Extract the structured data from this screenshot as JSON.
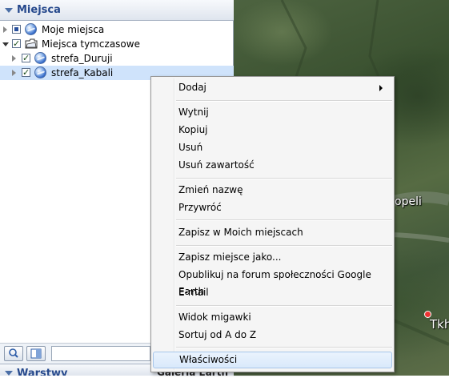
{
  "panel": {
    "title": "Miejsca",
    "tree": [
      {
        "label": "Moje miejsca"
      },
      {
        "label": "Miejsca tymczasowe"
      },
      {
        "label": "strefa_Duruji"
      },
      {
        "label": "strefa_Kabali"
      }
    ],
    "bottom": {
      "layers_title": "Warstwy",
      "gallery_label": "Galeria Earth"
    }
  },
  "map": {
    "labels": [
      "opeli",
      "Tkh"
    ]
  },
  "context_menu": {
    "items": [
      {
        "label": "Dodaj",
        "submenu": true
      },
      {
        "label": "Wytnij"
      },
      {
        "label": "Kopiuj"
      },
      {
        "label": "Usuń"
      },
      {
        "label": "Usuń zawartość"
      },
      {
        "label": "Zmień nazwę"
      },
      {
        "label": "Przywróć"
      },
      {
        "label": "Zapisz w Moich miejscach"
      },
      {
        "label": "Zapisz miejsce jako..."
      },
      {
        "label": "Opublikuj na forum społeczności Google Earth"
      },
      {
        "label": "E-mail"
      },
      {
        "label": "Widok migawki"
      },
      {
        "label": "Sortuj od A do Z"
      },
      {
        "label": "Właściwości",
        "highlighted": true
      }
    ]
  },
  "colors": {
    "header_text": "#25488c",
    "selection": "#cfe3fb",
    "menu_background": "#f5f5f5",
    "menu_highlight": "#d9e9fb"
  },
  "icons": {
    "places": "globe-icon",
    "temporary": "folder-icon",
    "search": "search-icon",
    "panel_toggle": "panel-toggle-icon"
  }
}
